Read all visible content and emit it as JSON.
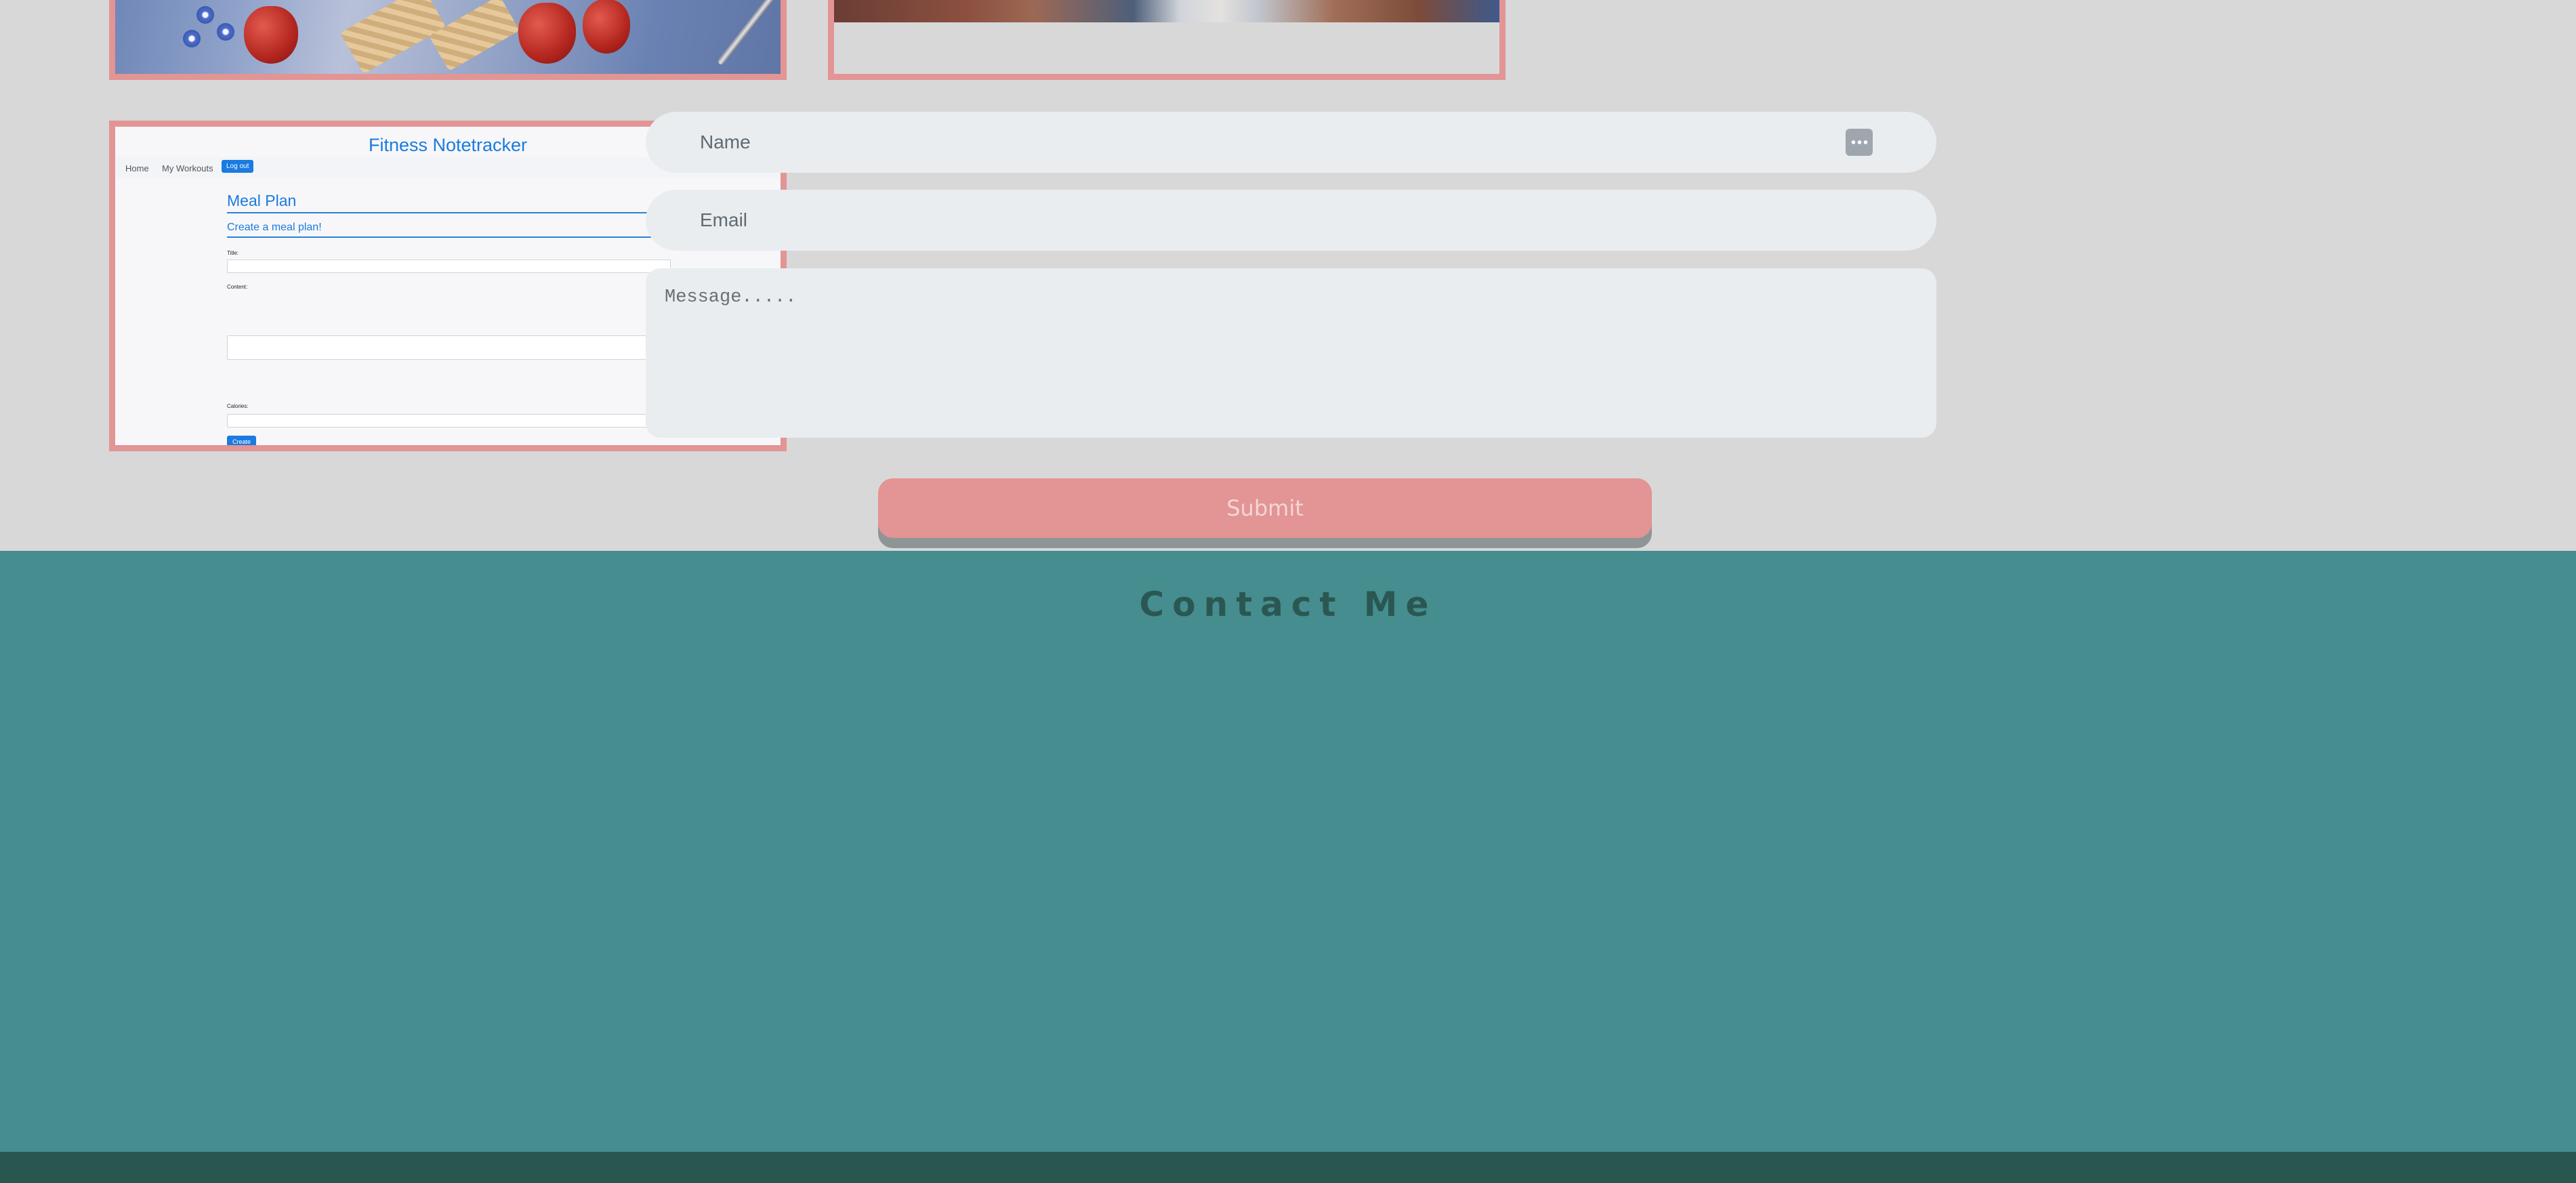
{
  "projects": {
    "fitness": {
      "title": "Fitness Notetracker",
      "nav": {
        "home": "Home",
        "workouts": "My Workouts",
        "logout": "Log out"
      },
      "form": {
        "heading": "Meal Plan",
        "subheading": "Create a meal plan!",
        "title_label": "Title:",
        "content_label": "Content:",
        "calories_label": "Calories:",
        "create_label": "Create"
      }
    }
  },
  "contact": {
    "heading": "Contact Me",
    "name_placeholder": "Name",
    "email_placeholder": "Email",
    "message_placeholder": "Message.....",
    "submit_label": "Submit"
  },
  "colors": {
    "page_background": "#d8d8d8",
    "card_border": "#e39494",
    "contact_background": "#458d8f",
    "heading_color": "#2b5752",
    "footer": "#2a5650"
  },
  "icons": {
    "name_field_autofill": "autofill-dots-icon"
  }
}
